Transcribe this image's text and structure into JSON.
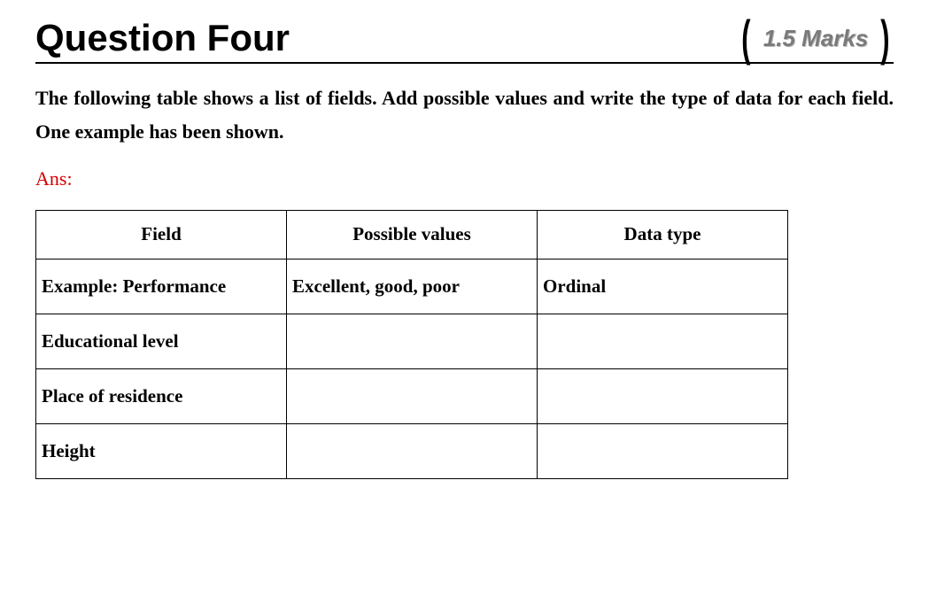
{
  "title": "Question Four",
  "marks": "1.5 Marks",
  "prompt": "The following table shows a list of fields. Add possible values and write the type of data for each field. One example has been shown.",
  "answer_label": "Ans:",
  "table": {
    "headers": [
      "Field",
      "Possible values",
      "Data type"
    ],
    "rows": [
      {
        "field": "Example: Performance",
        "possible": "Excellent, good, poor",
        "dtype": "Ordinal"
      },
      {
        "field": "Educational level",
        "possible": "",
        "dtype": ""
      },
      {
        "field": "Place of residence",
        "possible": "",
        "dtype": ""
      },
      {
        "field": "Height",
        "possible": "",
        "dtype": ""
      }
    ]
  }
}
